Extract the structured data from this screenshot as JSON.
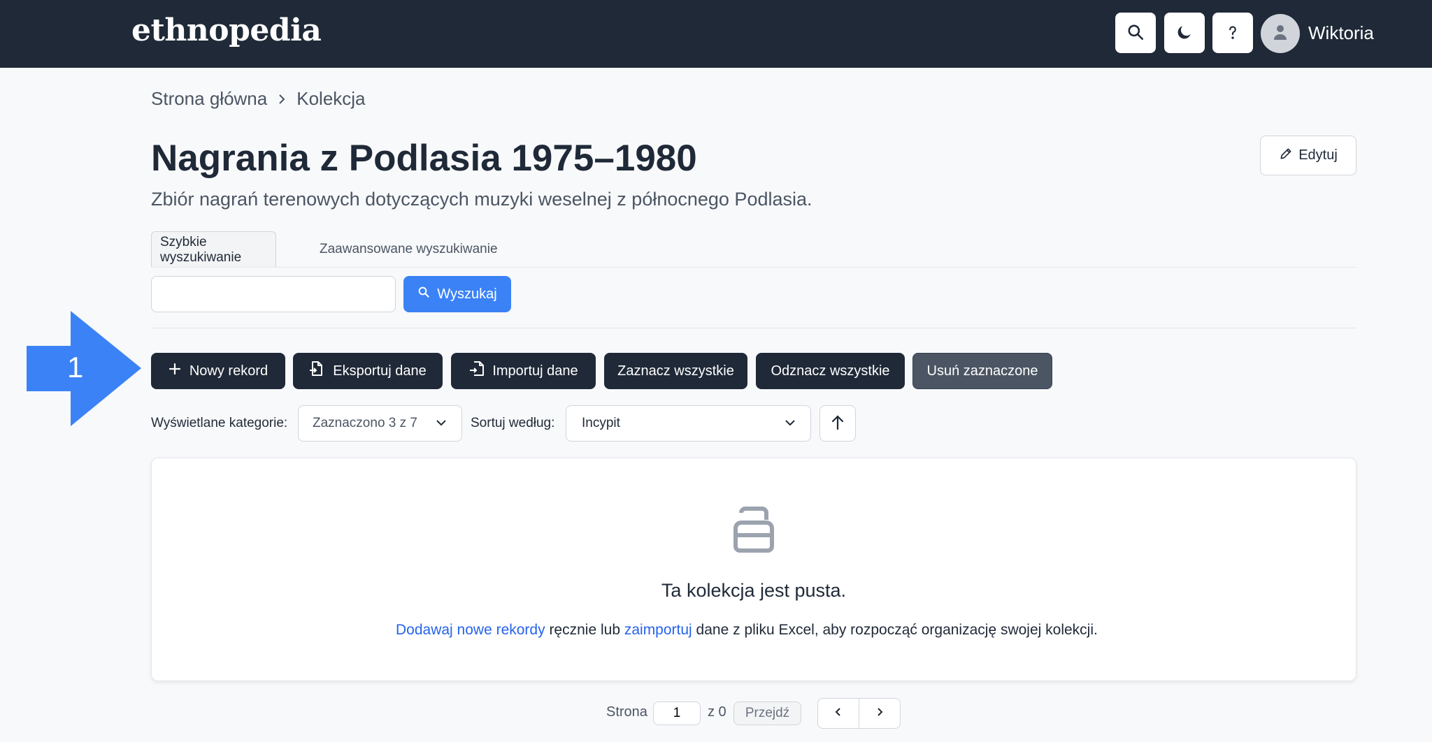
{
  "header": {
    "logo": "ethnopedia",
    "user_name": "Wiktoria",
    "icons": [
      "search-icon",
      "moon-icon",
      "help-icon",
      "user-icon"
    ]
  },
  "breadcrumb": {
    "home": "Strona główna",
    "current": "Kolekcja"
  },
  "page": {
    "title": "Nagrania z Podlasia 1975–1980",
    "subtitle": "Zbiór nagrań terenowych dotyczących muzyki weselnej z północnego Podlasia.",
    "edit_label": "Edytuj"
  },
  "tabs": [
    {
      "label": "Szybkie wyszukiwanie",
      "active": true
    },
    {
      "label": "Zaawansowane wyszukiwanie",
      "active": false
    }
  ],
  "search": {
    "value": "",
    "placeholder": "",
    "button_label": "Wyszukaj"
  },
  "annotation": {
    "number": "1",
    "color": "#3b82f6"
  },
  "actions": {
    "new_record": "Nowy rekord",
    "export": "Eksportuj dane",
    "import": "Importuj dane",
    "select_all": "Zaznacz wszystkie",
    "deselect_all": "Odznacz wszystkie",
    "delete_selected": "Usuń zaznaczone"
  },
  "filters": {
    "categories_label": "Wyświetlane kategorie:",
    "categories_value": "Zaznaczono 3 z 7",
    "sort_label": "Sortuj według:",
    "sort_value": "Incypit"
  },
  "empty": {
    "title": "Ta kolekcja jest pusta.",
    "link_add": "Dodawaj nowe rekordy",
    "text_mid": " ręcznie lub ",
    "link_import": "zaimportuj",
    "text_end": " dane z pliku Excel, aby rozpocząć organizację swojej kolekcji."
  },
  "pagination": {
    "page_label": "Strona",
    "page_value": "1",
    "of_label": "z 0",
    "go_label": "Przejdź"
  },
  "colors": {
    "nav_bg": "#1f2937",
    "primary": "#3b82f6",
    "dark_button": "#1f2937",
    "link": "#2563eb"
  }
}
